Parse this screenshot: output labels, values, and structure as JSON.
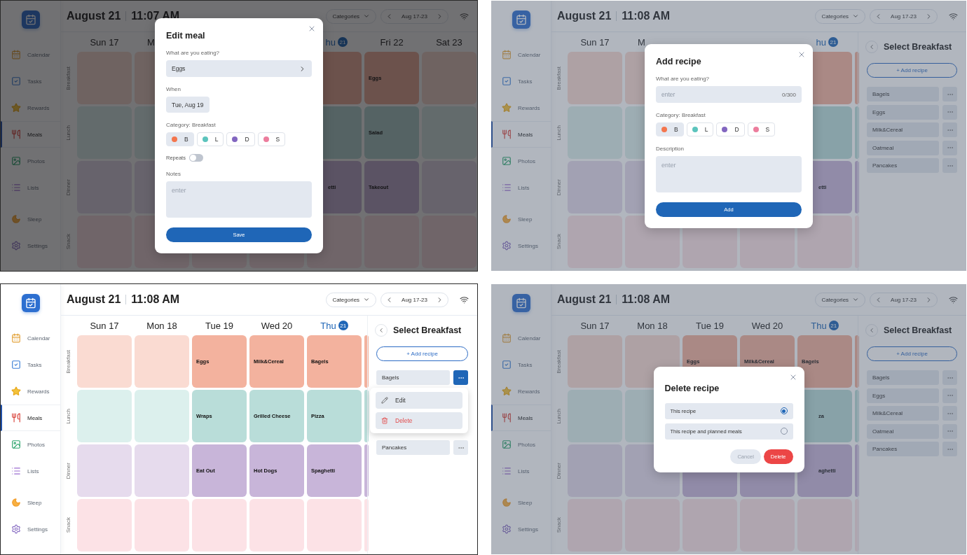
{
  "screens": [
    {
      "framed": true,
      "overlay_dark": true,
      "header": {
        "date": "August 21",
        "time": "11:07 AM",
        "categories": "Categories",
        "week": "Aug 17-23"
      },
      "sidebar": [
        {
          "label": "Calendar",
          "selected": false
        },
        {
          "label": "Tasks",
          "selected": false
        },
        {
          "label": "Rewards",
          "selected": false
        },
        {
          "label": "Meals",
          "selected": true
        },
        {
          "label": "Photos",
          "selected": false
        },
        {
          "label": "Lists",
          "selected": false
        },
        {
          "label": "Sleep",
          "selected": false
        },
        {
          "label": "Settings",
          "selected": false
        }
      ],
      "days": [
        {
          "label": "Sun 17",
          "today": false
        },
        {
          "label": "M",
          "today": false,
          "cut_right": true
        },
        {
          "label": "hu",
          "number": "21",
          "today": true,
          "cut_left": true
        },
        {
          "label": "Fri 22",
          "today": false
        },
        {
          "label": "Sat 23",
          "today": false
        }
      ],
      "meal_rows": [
        {
          "label": "Breakfast",
          "kind": "breakfast",
          "cells": [
            {
              "planned": false
            },
            {
              "planned": false
            },
            {},
            {},
            {
              "planned": true
            },
            {
              "planned": true,
              "meal": "Eggs"
            },
            {
              "planned": false
            }
          ]
        },
        {
          "label": "Lunch",
          "kind": "lunch",
          "cells": [
            {
              "planned": false
            },
            {
              "planned": false
            },
            {},
            {},
            {
              "planned": true
            },
            {
              "planned": true,
              "meal": "Salad"
            },
            {
              "planned": false
            }
          ]
        },
        {
          "label": "Dinner",
          "kind": "dinner",
          "cells": [
            {
              "planned": false
            },
            {
              "planned": false
            },
            {},
            {},
            {
              "planned": true,
              "meal": "etti",
              "cut_left": true
            },
            {
              "planned": true,
              "meal": "Takeout"
            },
            {
              "planned": false
            }
          ]
        },
        {
          "label": "Snack",
          "kind": "snack",
          "cells": [
            {
              "planned": false
            },
            {
              "planned": false
            },
            {
              "planned": false
            },
            {
              "planned": false
            },
            {
              "planned": false
            },
            {
              "planned": false
            },
            {
              "planned": false
            }
          ]
        }
      ],
      "dialog": {
        "kind": "form",
        "title": "Edit meal",
        "fields": [
          {
            "kind": "select",
            "label": "What are you eating?",
            "value": "Eggs"
          },
          {
            "kind": "date",
            "label": "When",
            "value": "Tue, Aug 19"
          },
          {
            "kind": "categories",
            "label": "Category: Breakfast",
            "options": [
              {
                "letter": "B",
                "color": "#f4764d",
                "selected": true
              },
              {
                "letter": "L",
                "color": "#5cc4bd",
                "selected": false
              },
              {
                "letter": "D",
                "color": "#8266c0",
                "selected": false
              },
              {
                "letter": "S",
                "color": "#ec7d9d",
                "selected": false
              }
            ]
          },
          {
            "kind": "toggle",
            "label": "Repeats",
            "on": false
          },
          {
            "kind": "textarea",
            "label": "Notes",
            "placeholder": "enter"
          }
        ],
        "actions": [
          {
            "label": "Save",
            "kind": "primary"
          }
        ]
      }
    },
    {
      "framed": false,
      "overlay_dark": false,
      "header": {
        "date": "August 21",
        "time": "11:08 AM",
        "categories": "Categories",
        "week": "Aug 17-23"
      },
      "sidebar": [
        {
          "label": "Calendar",
          "selected": false
        },
        {
          "label": "Tasks",
          "selected": false
        },
        {
          "label": "Rewards",
          "selected": false
        },
        {
          "label": "Meals",
          "selected": true
        },
        {
          "label": "Photos",
          "selected": false
        },
        {
          "label": "Lists",
          "selected": false
        },
        {
          "label": "Sleep",
          "selected": false
        },
        {
          "label": "Settings",
          "selected": false
        }
      ],
      "days": [
        {
          "label": "Sun 17",
          "today": false
        },
        {
          "label": "M",
          "today": false,
          "cut_right": true
        },
        {
          "label": "hu",
          "number": "21",
          "today": true,
          "cut_left": true
        }
      ],
      "meal_rows": [
        {
          "label": "Breakfast",
          "kind": "breakfast",
          "cells": [
            {
              "planned": false
            },
            {
              "planned": false
            },
            {},
            {},
            {
              "planned": true
            },
            {
              "planned": true
            }
          ]
        },
        {
          "label": "Lunch",
          "kind": "lunch",
          "cells": [
            {
              "planned": false
            },
            {
              "planned": false
            },
            {},
            {},
            {
              "planned": true
            },
            {
              "planned": true
            }
          ]
        },
        {
          "label": "Dinner",
          "kind": "dinner",
          "cells": [
            {
              "planned": false
            },
            {
              "planned": false
            },
            {},
            {},
            {
              "planned": true,
              "meal": "etti",
              "cut_left": true
            },
            {
              "planned": true
            }
          ]
        },
        {
          "label": "Snack",
          "kind": "snack",
          "cells": [
            {
              "planned": false
            },
            {
              "planned": false
            },
            {
              "planned": false
            },
            {
              "planned": false
            },
            {
              "planned": false
            },
            {
              "planned": false
            }
          ]
        }
      ],
      "side_panel": {
        "title": "Select Breakfast",
        "add_label": "+ Add recipe",
        "recipes": [
          {
            "name": "Bagels",
            "menu_open": false
          },
          {
            "name": "Eggs",
            "menu_open": false
          },
          {
            "name": "Milk&Cereal",
            "menu_open": false
          },
          {
            "name": "Oatmeal",
            "menu_open": false
          },
          {
            "name": "Pancakes",
            "menu_open": false
          }
        ]
      },
      "dialog": {
        "kind": "form",
        "title": "Add recipe",
        "fields": [
          {
            "kind": "text_input",
            "label": "What are you eating?",
            "placeholder": "enter",
            "counter": "0/300"
          },
          {
            "kind": "categories",
            "label": "Category: Breakfast",
            "options": [
              {
                "letter": "B",
                "color": "#f4764d",
                "selected": true
              },
              {
                "letter": "L",
                "color": "#5cc4bd",
                "selected": false
              },
              {
                "letter": "D",
                "color": "#8266c0",
                "selected": false
              },
              {
                "letter": "S",
                "color": "#ec7d9d",
                "selected": false
              }
            ]
          },
          {
            "kind": "textarea",
            "label": "Description",
            "placeholder": "enter"
          }
        ],
        "actions": [
          {
            "label": "Add",
            "kind": "primary"
          }
        ]
      }
    },
    {
      "framed": true,
      "header": {
        "date": "August 21",
        "time": "11:08 AM",
        "categories": "Categories",
        "week": "Aug 17-23"
      },
      "sidebar": [
        {
          "label": "Calendar",
          "selected": false
        },
        {
          "label": "Tasks",
          "selected": false
        },
        {
          "label": "Rewards",
          "selected": false
        },
        {
          "label": "Meals",
          "selected": true
        },
        {
          "label": "Photos",
          "selected": false
        },
        {
          "label": "Lists",
          "selected": false
        },
        {
          "label": "Sleep",
          "selected": false
        },
        {
          "label": "Settings",
          "selected": false
        }
      ],
      "days": [
        {
          "label": "Sun 17",
          "today": false
        },
        {
          "label": "Mon 18",
          "today": false
        },
        {
          "label": "Tue 19",
          "today": false
        },
        {
          "label": "Wed 20",
          "today": false
        },
        {
          "label": "Thu",
          "number": "21",
          "today": true
        }
      ],
      "meal_rows": [
        {
          "label": "Breakfast",
          "kind": "breakfast",
          "cells": [
            {
              "planned": false
            },
            {
              "planned": false
            },
            {
              "planned": true,
              "meal": "Eggs"
            },
            {
              "planned": true,
              "meal": "Milk&Cereal"
            },
            {
              "planned": true,
              "meal": "Bagels"
            },
            {
              "planned": true
            }
          ]
        },
        {
          "label": "Lunch",
          "kind": "lunch",
          "cells": [
            {
              "planned": false
            },
            {
              "planned": false
            },
            {
              "planned": true,
              "meal": "Wraps"
            },
            {
              "planned": true,
              "meal": "Grilled Cheese"
            },
            {
              "planned": true,
              "meal": "Pizza"
            },
            {
              "planned": true
            }
          ]
        },
        {
          "label": "Dinner",
          "kind": "dinner",
          "cells": [
            {
              "planned": false
            },
            {
              "planned": false
            },
            {
              "planned": true,
              "meal": "Eat Out"
            },
            {
              "planned": true,
              "meal": "Hot Dogs"
            },
            {
              "planned": true,
              "meal": "Spaghetti"
            },
            {
              "planned": true
            }
          ]
        },
        {
          "label": "Snack",
          "kind": "snack",
          "cells": [
            {
              "planned": false
            },
            {
              "planned": false
            },
            {
              "planned": false
            },
            {
              "planned": false
            },
            {
              "planned": false
            },
            {
              "planned": false
            }
          ]
        }
      ],
      "side_panel": {
        "title": "Select Breakfast",
        "add_label": "+ Add recipe",
        "recipes": [
          {
            "name": "Bagels",
            "menu_open": true
          },
          {
            "name": "Pancakes",
            "menu_open": false
          }
        ],
        "menu": [
          {
            "label": "Edit",
            "kind": "edit"
          },
          {
            "label": "Delete",
            "kind": "delete"
          }
        ]
      }
    },
    {
      "framed": false,
      "overlay_dark": false,
      "header": {
        "date": "August 21",
        "time": "11:08 AM",
        "categories": "Categories",
        "week": "Aug 17-23"
      },
      "sidebar": [
        {
          "label": "Calendar",
          "selected": false
        },
        {
          "label": "Tasks",
          "selected": false
        },
        {
          "label": "Rewards",
          "selected": false
        },
        {
          "label": "Meals",
          "selected": true
        },
        {
          "label": "Photos",
          "selected": false
        },
        {
          "label": "Lists",
          "selected": false
        },
        {
          "label": "Sleep",
          "selected": false
        },
        {
          "label": "Settings",
          "selected": false
        }
      ],
      "days": [
        {
          "label": "Sun 17",
          "today": false
        },
        {
          "label": "Mon 18",
          "today": false
        },
        {
          "label": "Tue 19",
          "today": false
        },
        {
          "label": "Wed 20",
          "today": false
        },
        {
          "label": "Thu",
          "number": "21",
          "today": true
        }
      ],
      "meal_rows": [
        {
          "label": "Breakfast",
          "kind": "breakfast",
          "cells": [
            {
              "planned": false
            },
            {
              "planned": false
            },
            {
              "planned": true,
              "meal": "Eggs"
            },
            {
              "planned": true,
              "meal": "Milk&Cereal"
            },
            {
              "planned": true,
              "meal": "Bagels"
            },
            {
              "planned": true
            }
          ]
        },
        {
          "label": "Lunch",
          "kind": "lunch",
          "cells": [
            {
              "planned": false
            },
            {
              "planned": false
            },
            {},
            {},
            {
              "planned": true,
              "meal": "za",
              "cut_left": true
            },
            {
              "planned": true
            }
          ]
        },
        {
          "label": "Dinner",
          "kind": "dinner",
          "cells": [
            {
              "planned": false
            },
            {
              "planned": false
            },
            {
              "planned": true
            },
            {
              "planned": true
            },
            {
              "planned": true,
              "meal": "aghetti",
              "cut_left": true
            },
            {
              "planned": true
            }
          ]
        },
        {
          "label": "Snack",
          "kind": "snack",
          "cells": [
            {
              "planned": false
            },
            {
              "planned": false
            },
            {
              "planned": false
            },
            {
              "planned": false
            },
            {
              "planned": false
            },
            {
              "planned": false
            }
          ]
        }
      ],
      "side_panel": {
        "title": "Select Breakfast",
        "add_label": "+ Add recipe",
        "recipes": [
          {
            "name": "Bagels",
            "menu_open": false
          },
          {
            "name": "Eggs",
            "menu_open": false
          },
          {
            "name": "Milk&Cereal",
            "menu_open": false
          },
          {
            "name": "Oatmeal",
            "menu_open": false
          },
          {
            "name": "Pancakes",
            "menu_open": false
          }
        ]
      },
      "dialog": {
        "kind": "confirm",
        "title": "Delete recipe",
        "fields": [
          {
            "kind": "radio",
            "options": [
              {
                "label": "This recipe",
                "selected": true
              },
              {
                "label": "This recipe and planned meals",
                "selected": false
              }
            ]
          }
        ],
        "actions": [
          {
            "label": "Cancel",
            "kind": "secondary"
          },
          {
            "label": "Delete",
            "kind": "danger"
          }
        ]
      }
    }
  ]
}
